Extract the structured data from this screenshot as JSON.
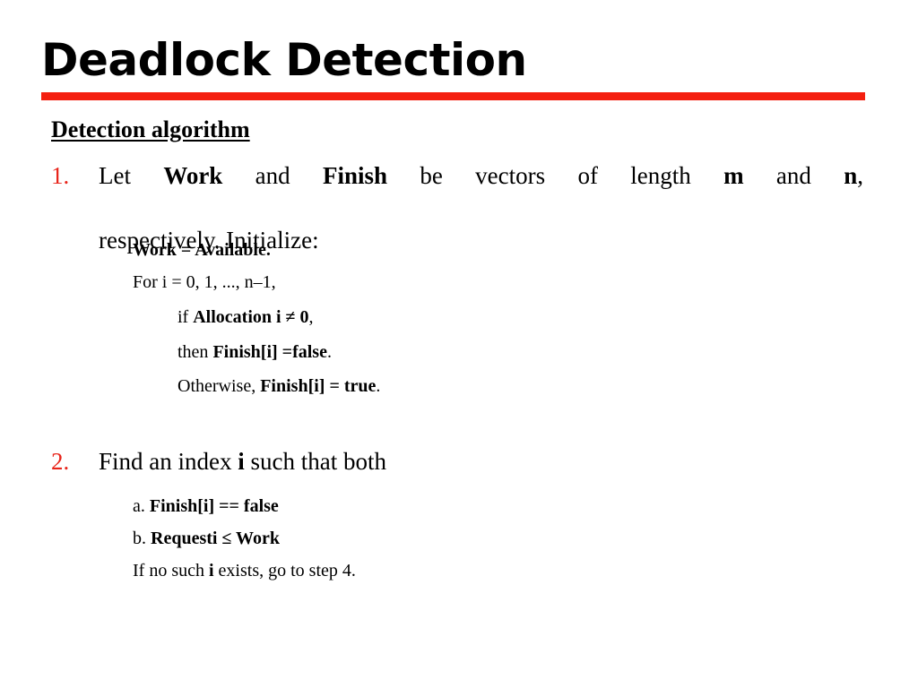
{
  "slide": {
    "title": "Deadlock Detection",
    "accent_color": "#f41f10",
    "number_color": "#e8251b",
    "background_color": "#ffffff",
    "text_color": "#000000"
  },
  "section": {
    "heading": "Detection algorithm"
  },
  "steps": [
    {
      "number": "1.",
      "line1_a": "Let ",
      "line1_b": "Work",
      "line1_c": " and ",
      "line1_d": "Finish",
      "line1_e": " be vectors of length ",
      "line1_f": "m",
      "line1_g": " and ",
      "line1_h": "n",
      "line1_i": ",",
      "line2": "respectively. Initialize:"
    },
    {
      "number": "2.",
      "text_a": "Find an index ",
      "text_b": "i",
      "text_c": " such that both"
    }
  ],
  "sublines": {
    "work_assign": "Work = Available.",
    "for_loop": "For i = 0, 1, ..., n–1,",
    "if_cond_pre": "if ",
    "if_cond_bold": "Allocation i ≠ 0",
    "if_cond_post": ",",
    "then_pre": "then ",
    "then_bold": "Finish[i] =false",
    "then_post": ".",
    "otherwise_pre": "Otherwise, ",
    "otherwise_bold": "Finish[i] = true",
    "otherwise_post": ".",
    "item_a_label": "a. ",
    "item_a_bold": "Finish[i] == false",
    "item_b_label": "b. ",
    "item_b_bold": "Requesti ≤ Work",
    "no_index_pre": "If no such ",
    "no_index_bold": "i",
    "no_index_post": " exists, go to step 4."
  }
}
